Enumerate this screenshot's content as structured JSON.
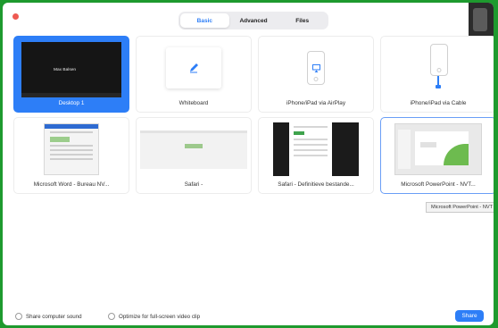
{
  "tabs": [
    "Basic",
    "Advanced",
    "Files"
  ],
  "tiles": {
    "desktop": {
      "label": "Desktop 1",
      "thumb_name": "Max Balsen"
    },
    "whiteboard": {
      "label": "Whiteboard"
    },
    "airplay": {
      "label": "iPhone/iPad via AirPlay"
    },
    "cable": {
      "label": "iPhone/iPad via Cable"
    },
    "word": {
      "label": "Microsoft Word - Bureau NV..."
    },
    "safari1": {
      "label": "Safari -"
    },
    "safari2": {
      "label": "Safari - Definitieve bestande..."
    },
    "ppt": {
      "label": "Microsoft PowerPoint - NVT..."
    }
  },
  "tooltip": "Microsoft PowerPoint - NVT",
  "options": {
    "share_sound": "Share computer sound",
    "optimize_video": "Optimize for full-screen video clip"
  },
  "share_button": "Share",
  "colors": {
    "accent": "#2d7ef7",
    "frame": "#1e9a2e"
  }
}
